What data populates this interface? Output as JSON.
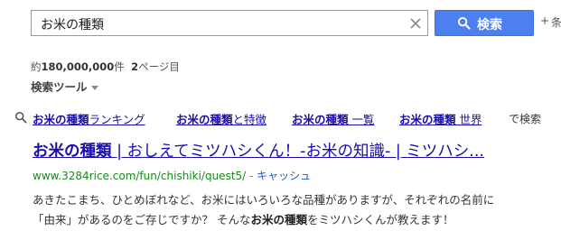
{
  "search": {
    "query": "お米の種類",
    "button_label": "検索",
    "extra_label": "条"
  },
  "stats": {
    "prefix": "約",
    "count": "180,000,000",
    "unit": "件",
    "page_num": "2",
    "page_suffix": "ページ目"
  },
  "tools": {
    "label": "検索ツール"
  },
  "related": {
    "items": [
      {
        "bold": "お米の種類",
        "rest": "ランキング"
      },
      {
        "bold": "お米の種類",
        "rest": "と特徴"
      },
      {
        "bold": "お米の種類",
        "rest": " 一覧"
      },
      {
        "bold": "お米の種類",
        "rest": " 世界"
      }
    ],
    "suffix": "で検索"
  },
  "result": {
    "title_bold": "お米の種類",
    "title_rest": " | おしえてミツハシくん！-お米の知識- | ミツハシ...",
    "url": "www.3284rice.com/fun/chishiki/quest5/",
    "separator": " - ",
    "cache": "キャッシュ",
    "snippet_line1": "あきたこまち、ひとめぼれなど、お米にはいろいろな品種がありますが、それぞれの名前に",
    "snippet_line2_a": "「由来」があるのをご存じですか？ そんな",
    "snippet_line2_bold": "お米の種類",
    "snippet_line2_b": "をミツハシくんが教えます！"
  },
  "colors": {
    "link": "#1a0dab",
    "url_green": "#1a8a1a",
    "button_blue": "#4d7ff0"
  }
}
